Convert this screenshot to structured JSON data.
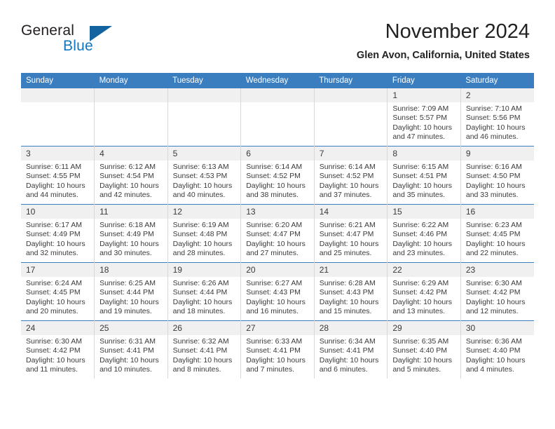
{
  "brand": {
    "name_part1": "General",
    "name_part2": "Blue",
    "flag_icon": "triangle-flag-icon",
    "accent_color": "#1077bf"
  },
  "header": {
    "title": "November 2024",
    "subtitle": "Glen Avon, California, United States"
  },
  "calendar": {
    "header_bg": "#3b7ec0",
    "daynum_bg": "#f0f0f0",
    "weekdays": [
      "Sunday",
      "Monday",
      "Tuesday",
      "Wednesday",
      "Thursday",
      "Friday",
      "Saturday"
    ],
    "weeks": [
      [
        {
          "day": "",
          "empty": true
        },
        {
          "day": "",
          "empty": true
        },
        {
          "day": "",
          "empty": true
        },
        {
          "day": "",
          "empty": true
        },
        {
          "day": "",
          "empty": true
        },
        {
          "day": "1",
          "sunrise": "Sunrise: 7:09 AM",
          "sunset": "Sunset: 5:57 PM",
          "daylight": "Daylight: 10 hours and 47 minutes."
        },
        {
          "day": "2",
          "sunrise": "Sunrise: 7:10 AM",
          "sunset": "Sunset: 5:56 PM",
          "daylight": "Daylight: 10 hours and 46 minutes."
        }
      ],
      [
        {
          "day": "3",
          "sunrise": "Sunrise: 6:11 AM",
          "sunset": "Sunset: 4:55 PM",
          "daylight": "Daylight: 10 hours and 44 minutes."
        },
        {
          "day": "4",
          "sunrise": "Sunrise: 6:12 AM",
          "sunset": "Sunset: 4:54 PM",
          "daylight": "Daylight: 10 hours and 42 minutes."
        },
        {
          "day": "5",
          "sunrise": "Sunrise: 6:13 AM",
          "sunset": "Sunset: 4:53 PM",
          "daylight": "Daylight: 10 hours and 40 minutes."
        },
        {
          "day": "6",
          "sunrise": "Sunrise: 6:14 AM",
          "sunset": "Sunset: 4:52 PM",
          "daylight": "Daylight: 10 hours and 38 minutes."
        },
        {
          "day": "7",
          "sunrise": "Sunrise: 6:14 AM",
          "sunset": "Sunset: 4:52 PM",
          "daylight": "Daylight: 10 hours and 37 minutes."
        },
        {
          "day": "8",
          "sunrise": "Sunrise: 6:15 AM",
          "sunset": "Sunset: 4:51 PM",
          "daylight": "Daylight: 10 hours and 35 minutes."
        },
        {
          "day": "9",
          "sunrise": "Sunrise: 6:16 AM",
          "sunset": "Sunset: 4:50 PM",
          "daylight": "Daylight: 10 hours and 33 minutes."
        }
      ],
      [
        {
          "day": "10",
          "sunrise": "Sunrise: 6:17 AM",
          "sunset": "Sunset: 4:49 PM",
          "daylight": "Daylight: 10 hours and 32 minutes."
        },
        {
          "day": "11",
          "sunrise": "Sunrise: 6:18 AM",
          "sunset": "Sunset: 4:49 PM",
          "daylight": "Daylight: 10 hours and 30 minutes."
        },
        {
          "day": "12",
          "sunrise": "Sunrise: 6:19 AM",
          "sunset": "Sunset: 4:48 PM",
          "daylight": "Daylight: 10 hours and 28 minutes."
        },
        {
          "day": "13",
          "sunrise": "Sunrise: 6:20 AM",
          "sunset": "Sunset: 4:47 PM",
          "daylight": "Daylight: 10 hours and 27 minutes."
        },
        {
          "day": "14",
          "sunrise": "Sunrise: 6:21 AM",
          "sunset": "Sunset: 4:47 PM",
          "daylight": "Daylight: 10 hours and 25 minutes."
        },
        {
          "day": "15",
          "sunrise": "Sunrise: 6:22 AM",
          "sunset": "Sunset: 4:46 PM",
          "daylight": "Daylight: 10 hours and 23 minutes."
        },
        {
          "day": "16",
          "sunrise": "Sunrise: 6:23 AM",
          "sunset": "Sunset: 4:45 PM",
          "daylight": "Daylight: 10 hours and 22 minutes."
        }
      ],
      [
        {
          "day": "17",
          "sunrise": "Sunrise: 6:24 AM",
          "sunset": "Sunset: 4:45 PM",
          "daylight": "Daylight: 10 hours and 20 minutes."
        },
        {
          "day": "18",
          "sunrise": "Sunrise: 6:25 AM",
          "sunset": "Sunset: 4:44 PM",
          "daylight": "Daylight: 10 hours and 19 minutes."
        },
        {
          "day": "19",
          "sunrise": "Sunrise: 6:26 AM",
          "sunset": "Sunset: 4:44 PM",
          "daylight": "Daylight: 10 hours and 18 minutes."
        },
        {
          "day": "20",
          "sunrise": "Sunrise: 6:27 AM",
          "sunset": "Sunset: 4:43 PM",
          "daylight": "Daylight: 10 hours and 16 minutes."
        },
        {
          "day": "21",
          "sunrise": "Sunrise: 6:28 AM",
          "sunset": "Sunset: 4:43 PM",
          "daylight": "Daylight: 10 hours and 15 minutes."
        },
        {
          "day": "22",
          "sunrise": "Sunrise: 6:29 AM",
          "sunset": "Sunset: 4:42 PM",
          "daylight": "Daylight: 10 hours and 13 minutes."
        },
        {
          "day": "23",
          "sunrise": "Sunrise: 6:30 AM",
          "sunset": "Sunset: 4:42 PM",
          "daylight": "Daylight: 10 hours and 12 minutes."
        }
      ],
      [
        {
          "day": "24",
          "sunrise": "Sunrise: 6:30 AM",
          "sunset": "Sunset: 4:42 PM",
          "daylight": "Daylight: 10 hours and 11 minutes."
        },
        {
          "day": "25",
          "sunrise": "Sunrise: 6:31 AM",
          "sunset": "Sunset: 4:41 PM",
          "daylight": "Daylight: 10 hours and 10 minutes."
        },
        {
          "day": "26",
          "sunrise": "Sunrise: 6:32 AM",
          "sunset": "Sunset: 4:41 PM",
          "daylight": "Daylight: 10 hours and 8 minutes."
        },
        {
          "day": "27",
          "sunrise": "Sunrise: 6:33 AM",
          "sunset": "Sunset: 4:41 PM",
          "daylight": "Daylight: 10 hours and 7 minutes."
        },
        {
          "day": "28",
          "sunrise": "Sunrise: 6:34 AM",
          "sunset": "Sunset: 4:41 PM",
          "daylight": "Daylight: 10 hours and 6 minutes."
        },
        {
          "day": "29",
          "sunrise": "Sunrise: 6:35 AM",
          "sunset": "Sunset: 4:40 PM",
          "daylight": "Daylight: 10 hours and 5 minutes."
        },
        {
          "day": "30",
          "sunrise": "Sunrise: 6:36 AM",
          "sunset": "Sunset: 4:40 PM",
          "daylight": "Daylight: 10 hours and 4 minutes."
        }
      ]
    ]
  }
}
